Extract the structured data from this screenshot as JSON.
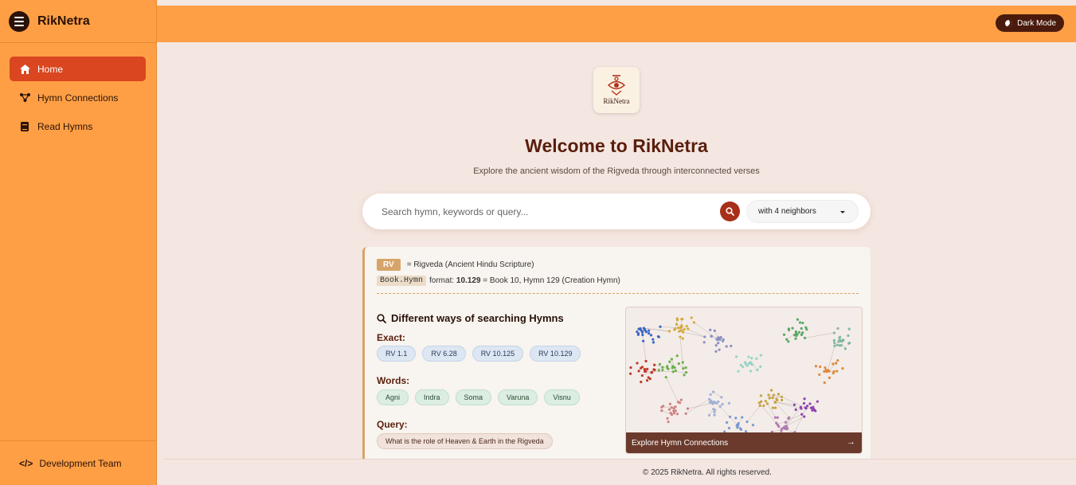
{
  "sidebar": {
    "brand": "RikNetra",
    "items": [
      {
        "label": "Home",
        "icon": "home-icon",
        "active": true
      },
      {
        "label": "Hymn Connections",
        "icon": "network-icon",
        "active": false
      },
      {
        "label": "Read Hymns",
        "icon": "book-icon",
        "active": false
      }
    ],
    "footer_code": "</>",
    "footer_label": "Development Team"
  },
  "topbar": {
    "dark_mode_label": "Dark Mode"
  },
  "main": {
    "logo_text": "RikNetra",
    "title": "Welcome to RikNetra",
    "subtitle": "Explore the ancient wisdom of the Rigveda through interconnected verses",
    "search": {
      "placeholder": "Search hymn, keywords or query...",
      "value": "",
      "neighbors_selected": "with 4 neighbors"
    },
    "info": {
      "rv_badge": "RV",
      "rv_desc": "= Rigveda (Ancient Hindu Scripture)",
      "format_code": "Book.Hymn",
      "format_text": "format:",
      "format_example": "10.129",
      "format_desc": "= Book 10, Hymn 129 (Creation Hymn)"
    },
    "ways": {
      "title": "Different ways of searching Hymns",
      "exact_label": "Exact:",
      "exact": [
        "RV 1.1",
        "RV 6.28",
        "RV 10.125",
        "RV 10.129"
      ],
      "words_label": "Words:",
      "words": [
        "Agni",
        "Indra",
        "Soma",
        "Varuna",
        "Visnu"
      ],
      "query_label": "Query:",
      "query": [
        "What is the role of Heaven & Earth in the Rigveda"
      ]
    },
    "graph": {
      "explore_label": "Explore Hymn Connections",
      "arrow": "→"
    }
  },
  "footer": {
    "copyright": "© 2025 RikNetra. All rights reserved."
  },
  "colors": {
    "sidebar": "#ff9f45",
    "active": "#d9461f",
    "background": "#f4e6e1",
    "title": "#5a1e0c",
    "search_button": "#a8301a"
  }
}
